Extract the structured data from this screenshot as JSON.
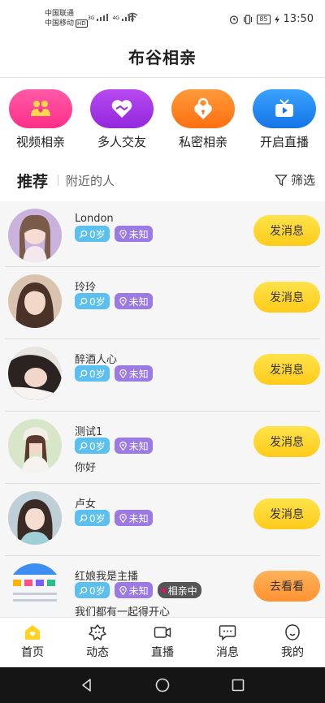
{
  "status": {
    "carrier1": "中国联通",
    "carrier2": "中国移动",
    "hd": "HD",
    "net1": "3G",
    "net2": "4G",
    "battery": "85",
    "time": "13:50"
  },
  "header": {
    "title": "布谷相亲"
  },
  "quick": [
    {
      "label": "视频相亲",
      "icon": "couple-icon",
      "color": "#ff3d96"
    },
    {
      "label": "多人交友",
      "icon": "handshake-heart-icon",
      "color": "#a237e6"
    },
    {
      "label": "私密相亲",
      "icon": "heart-lock-icon",
      "color": "#ff7a18"
    },
    {
      "label": "开启直播",
      "icon": "tv-icon",
      "color": "#1e88f0"
    }
  ],
  "tabs": {
    "active": "推荐",
    "other": "附近的人",
    "filter": "筛选"
  },
  "users": [
    {
      "name": "London",
      "age": "0岁",
      "location": "未知",
      "signature": "",
      "action": "发消息"
    },
    {
      "name": "玲玲",
      "age": "0岁",
      "location": "未知",
      "signature": "",
      "action": "发消息"
    },
    {
      "name": "醉酒人心",
      "age": "0岁",
      "location": "未知",
      "signature": "",
      "action": "发消息"
    },
    {
      "name": "测试1",
      "age": "0岁",
      "location": "未知",
      "signature": "你好",
      "action": "发消息"
    },
    {
      "name": "卢女",
      "age": "0岁",
      "location": "未知",
      "signature": "",
      "action": "发消息"
    },
    {
      "name": "红娘我是主播",
      "age": "0岁",
      "location": "未知",
      "live": "相亲中",
      "signature": "我们都有一起得开心",
      "action": "去看看"
    }
  ],
  "nav": [
    {
      "label": "首页",
      "icon": "home-icon"
    },
    {
      "label": "动态",
      "icon": "moments-icon"
    },
    {
      "label": "直播",
      "icon": "video-camera-icon"
    },
    {
      "label": "消息",
      "icon": "message-icon"
    },
    {
      "label": "我的",
      "icon": "profile-icon"
    }
  ],
  "colors": {
    "accent_yellow": "#ffd21f",
    "watch_orange": "#ff9a3c",
    "age_tag": "#5bc0f0",
    "location_tag": "#9b7ae6"
  }
}
